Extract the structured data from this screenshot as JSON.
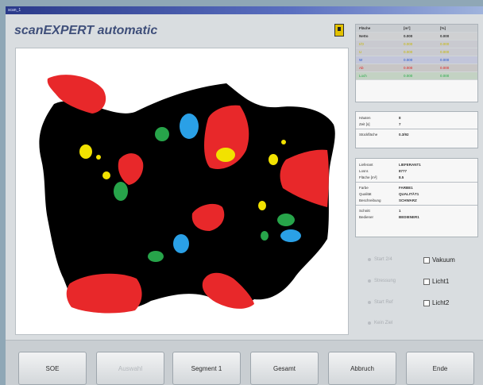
{
  "window": {
    "title": "scan_1"
  },
  "app": {
    "title": "scanEXPERT automatic"
  },
  "stats": {
    "headers": [
      "Fläche",
      "[m²]",
      "[%]"
    ],
    "rows": [
      {
        "label": "Netto",
        "m2": "0.000",
        "pct": "0.000",
        "bold": true
      },
      {
        "label": "I/O",
        "m2": "0.000",
        "pct": "0.000",
        "color": "#e3d400"
      },
      {
        "label": "U",
        "m2": "0.000",
        "pct": "0.000",
        "color": "#e3d400"
      },
      {
        "label": "W",
        "m2": "0.000",
        "pct": "0.000",
        "color": "#2255cc"
      },
      {
        "label": "Ab",
        "m2": "0.000",
        "pct": "0.000",
        "color": "#e02020"
      },
      {
        "label": "Loch",
        "m2": "0.000",
        "pct": "0.000",
        "color": "#22aa44"
      }
    ]
  },
  "summary": {
    "rows": [
      {
        "k": "Häuten",
        "v": "8"
      },
      {
        "k": "Zeit [s]",
        "v": "7"
      },
      {
        "k": "Stückfläche",
        "v": "0.3/92"
      }
    ]
  },
  "details": {
    "groups": [
      [
        {
          "k": "Lieferant",
          "v": "LIEFERANT1"
        },
        {
          "k": "Losnr.",
          "v": "8777"
        },
        {
          "k": "Fläche [m²]",
          "v": "8.5"
        }
      ],
      [
        {
          "k": "Farbe",
          "v": "FARBE1"
        },
        {
          "k": "Qualität",
          "v": "QUALITÄT1"
        },
        {
          "k": "Beschreibung",
          "v": "SCHWARZ"
        }
      ],
      [
        {
          "k": "Schnitt",
          "v": "1"
        },
        {
          "k": "Bediener",
          "v": "BEDIENER1"
        }
      ]
    ]
  },
  "options": {
    "radios": [
      "Start 2/4",
      "Stressung",
      "Start Ref",
      "Kein Ziel"
    ],
    "checks": [
      "Vakuum",
      "Licht1",
      "Licht2"
    ]
  },
  "buttons": [
    "SOE",
    "Auswahl",
    "Segment 1",
    "Gesamt",
    "Abbruch",
    "Ende"
  ],
  "colors": {
    "hide": "#000000",
    "zone_red": "#e8282a",
    "zone_yellow": "#f2e200",
    "zone_blue": "#2aa0e6",
    "zone_green": "#27a44a"
  }
}
